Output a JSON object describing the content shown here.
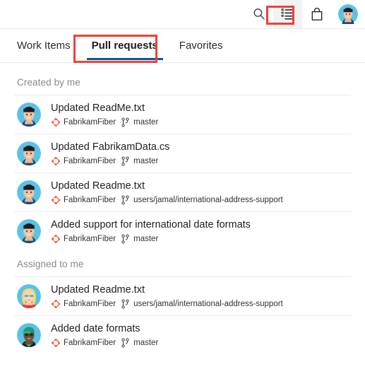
{
  "header": {
    "icons": [
      {
        "name": "search-icon",
        "label": "Search"
      },
      {
        "name": "work-list-icon",
        "label": "My work"
      },
      {
        "name": "marketplace-bag-icon",
        "label": "Marketplace"
      },
      {
        "name": "user-avatar",
        "label": "User profile"
      }
    ]
  },
  "tabs": [
    {
      "label": "Work Items",
      "selected": false
    },
    {
      "label": "Pull requests",
      "selected": true
    },
    {
      "label": "Favorites",
      "selected": false
    }
  ],
  "annotations": [
    {
      "name": "list-icon-highlight",
      "color": "#ef4136"
    },
    {
      "name": "pull-requests-tab-highlight",
      "color": "#ef4136"
    }
  ],
  "colors": {
    "accent": "#005a9e",
    "annotation": "#ef4136",
    "repo_icon": "#f05133",
    "section_header": "#8a8886",
    "divider": "#ececec"
  },
  "sections": [
    {
      "title": "Created by me",
      "items": [
        {
          "title": "Updated ReadMe.txt",
          "repo": "FabrikamFiber",
          "branch": "master",
          "avatar": "avatar-dark-hair-male"
        },
        {
          "title": "Updated FabrikamData.cs",
          "repo": "FabrikamFiber",
          "branch": "master",
          "avatar": "avatar-dark-hair-male"
        },
        {
          "title": "Updated Readme.txt",
          "repo": "FabrikamFiber",
          "branch": "users/jamal/international-address-support",
          "avatar": "avatar-dark-hair-male"
        },
        {
          "title": "Added support for international date formats",
          "repo": "FabrikamFiber",
          "branch": "master",
          "avatar": "avatar-dark-hair-male"
        }
      ]
    },
    {
      "title": "Assigned to me",
      "items": [
        {
          "title": "Updated Readme.txt",
          "repo": "FabrikamFiber",
          "branch": "users/jamal/international-address-support",
          "avatar": "avatar-blonde-female"
        },
        {
          "title": "Added date formats",
          "repo": "FabrikamFiber",
          "branch": "master",
          "avatar": "avatar-green-cap"
        }
      ]
    }
  ]
}
